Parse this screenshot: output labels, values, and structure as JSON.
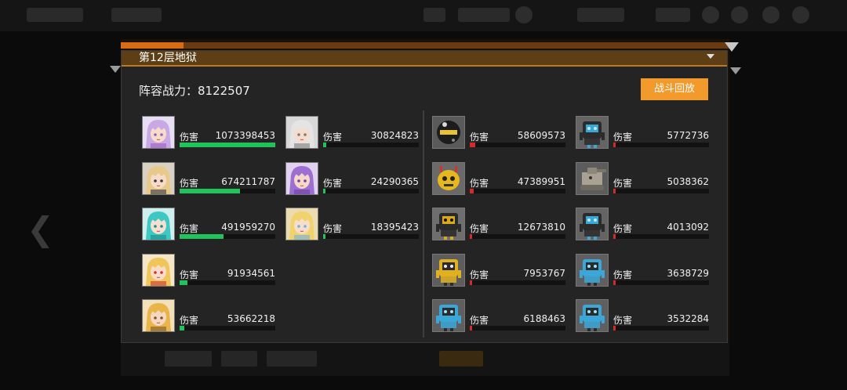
{
  "dialog": {
    "title": "第12层地狱",
    "power_label": "阵容战力：8122507",
    "replay_button": "战斗回放",
    "damage_label": "伤害"
  },
  "colors": {
    "ally_bar": "#1fc45a",
    "enemy_bar": "#d42a2a",
    "accent": "#f39a2c",
    "title_bar": "#5e3e14"
  },
  "allies": {
    "col1": [
      {
        "name": "ally-1",
        "icon": "girl-lilac-hair",
        "damage": "1073398453",
        "ratio": 1.0
      },
      {
        "name": "ally-2",
        "icon": "girl-blonde-dark-outfit",
        "damage": "674211787",
        "ratio": 0.628
      },
      {
        "name": "ally-3",
        "icon": "girl-teal-twin-tails",
        "damage": "491959270",
        "ratio": 0.458
      },
      {
        "name": "ally-4",
        "icon": "girl-blonde-red-ribbon",
        "damage": "91934561",
        "ratio": 0.086
      },
      {
        "name": "ally-5",
        "icon": "girl-golden-hair",
        "damage": "53662218",
        "ratio": 0.05
      }
    ],
    "col2": [
      {
        "name": "ally-6",
        "icon": "girl-white-hair",
        "damage": "30824823",
        "ratio": 0.029
      },
      {
        "name": "ally-7",
        "icon": "girl-purple-hair",
        "damage": "24290365",
        "ratio": 0.023
      },
      {
        "name": "ally-8",
        "icon": "girl-blonde-cap",
        "damage": "18395423",
        "ratio": 0.017
      }
    ]
  },
  "enemies": {
    "col1": [
      {
        "name": "enemy-1",
        "icon": "dark-sphere-bot",
        "damage": "58609573",
        "ratio": 0.055
      },
      {
        "name": "enemy-2",
        "icon": "yellow-round-bot",
        "damage": "47389951",
        "ratio": 0.044
      },
      {
        "name": "enemy-3",
        "icon": "black-yellow-robot",
        "damage": "12673810",
        "ratio": 0.012
      },
      {
        "name": "enemy-4",
        "icon": "yellow-box-robot",
        "damage": "7953767",
        "ratio": 0.007
      },
      {
        "name": "enemy-5",
        "icon": "blue-box-robot",
        "damage": "6188463",
        "ratio": 0.006
      }
    ],
    "col2": [
      {
        "name": "enemy-6",
        "icon": "blue-black-robot",
        "damage": "5772736",
        "ratio": 0.005
      },
      {
        "name": "enemy-7",
        "icon": "grey-tank-robot",
        "damage": "5038362",
        "ratio": 0.005
      },
      {
        "name": "enemy-8",
        "icon": "blue-black-robot",
        "damage": "4013092",
        "ratio": 0.004
      },
      {
        "name": "enemy-9",
        "icon": "blue-box-robot",
        "damage": "3638729",
        "ratio": 0.003
      },
      {
        "name": "enemy-10",
        "icon": "blue-box-robot",
        "damage": "3532284",
        "ratio": 0.003
      }
    ]
  }
}
